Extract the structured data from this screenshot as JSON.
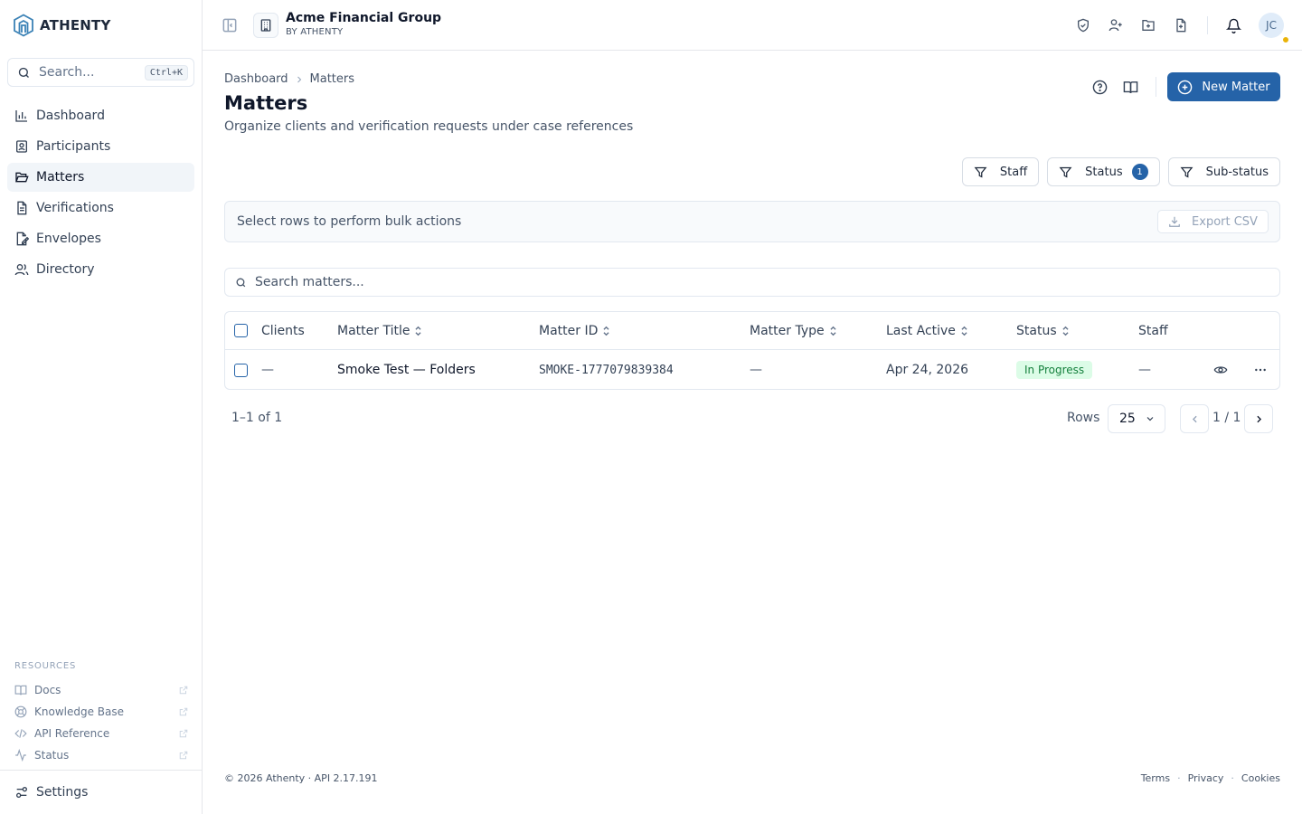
{
  "brand": {
    "name": "ATHENTY"
  },
  "search": {
    "placeholder": "Search...",
    "shortcut": "Ctrl+K"
  },
  "sidebar": {
    "items": [
      {
        "label": "Dashboard",
        "icon": "bar-chart-icon"
      },
      {
        "label": "Participants",
        "icon": "contact-icon"
      },
      {
        "label": "Matters",
        "icon": "folder-open-icon",
        "active": true
      },
      {
        "label": "Verifications",
        "icon": "file-text-icon"
      },
      {
        "label": "Envelopes",
        "icon": "file-signature-icon"
      },
      {
        "label": "Directory",
        "icon": "users-icon"
      }
    ],
    "resources_title": "RESOURCES",
    "resources": [
      {
        "label": "Docs",
        "icon": "book-icon"
      },
      {
        "label": "Knowledge Base",
        "icon": "lifebuoy-icon"
      },
      {
        "label": "API Reference",
        "icon": "code-icon"
      },
      {
        "label": "Status",
        "icon": "activity-icon"
      }
    ],
    "settings_label": "Settings"
  },
  "header": {
    "org_name": "Acme Financial Group",
    "org_sub": "BY ATHENTY",
    "avatar_initials": "JC"
  },
  "main": {
    "breadcrumb": [
      "Dashboard",
      "Matters"
    ],
    "title": "Matters",
    "subtitle": "Organize clients and verification requests under case references",
    "new_button": "New Matter",
    "filters": [
      {
        "label": "Staff"
      },
      {
        "label": "Status",
        "count": "1"
      },
      {
        "label": "Sub-status"
      }
    ],
    "bulk_text": "Select rows to perform bulk actions",
    "export_label": "Export CSV",
    "table_search_placeholder": "Search matters...",
    "columns": [
      "Clients",
      "Matter Title",
      "Matter ID",
      "Matter Type",
      "Last Active",
      "Status",
      "Staff"
    ],
    "rows": [
      {
        "clients": "—",
        "title": "Smoke Test — Folders",
        "matter_id": "SMOKE-1777079839384",
        "type": "—",
        "last_active": "Apr 24, 2026",
        "status": "In Progress",
        "staff": "—"
      }
    ],
    "pagination": {
      "count_text": "1–1 of 1",
      "rows_label": "Rows",
      "rows_value": "25",
      "page_text": "1 / 1"
    }
  },
  "footer": {
    "copyright": "© 2026 Athenty · API 2.17.191",
    "links": [
      "Terms",
      "Privacy",
      "Cookies"
    ]
  },
  "colors": {
    "accent": "#2563a8",
    "status_green_bg": "#dcfce7",
    "status_green_text": "#15803d",
    "notification_dot": "#eab308"
  }
}
